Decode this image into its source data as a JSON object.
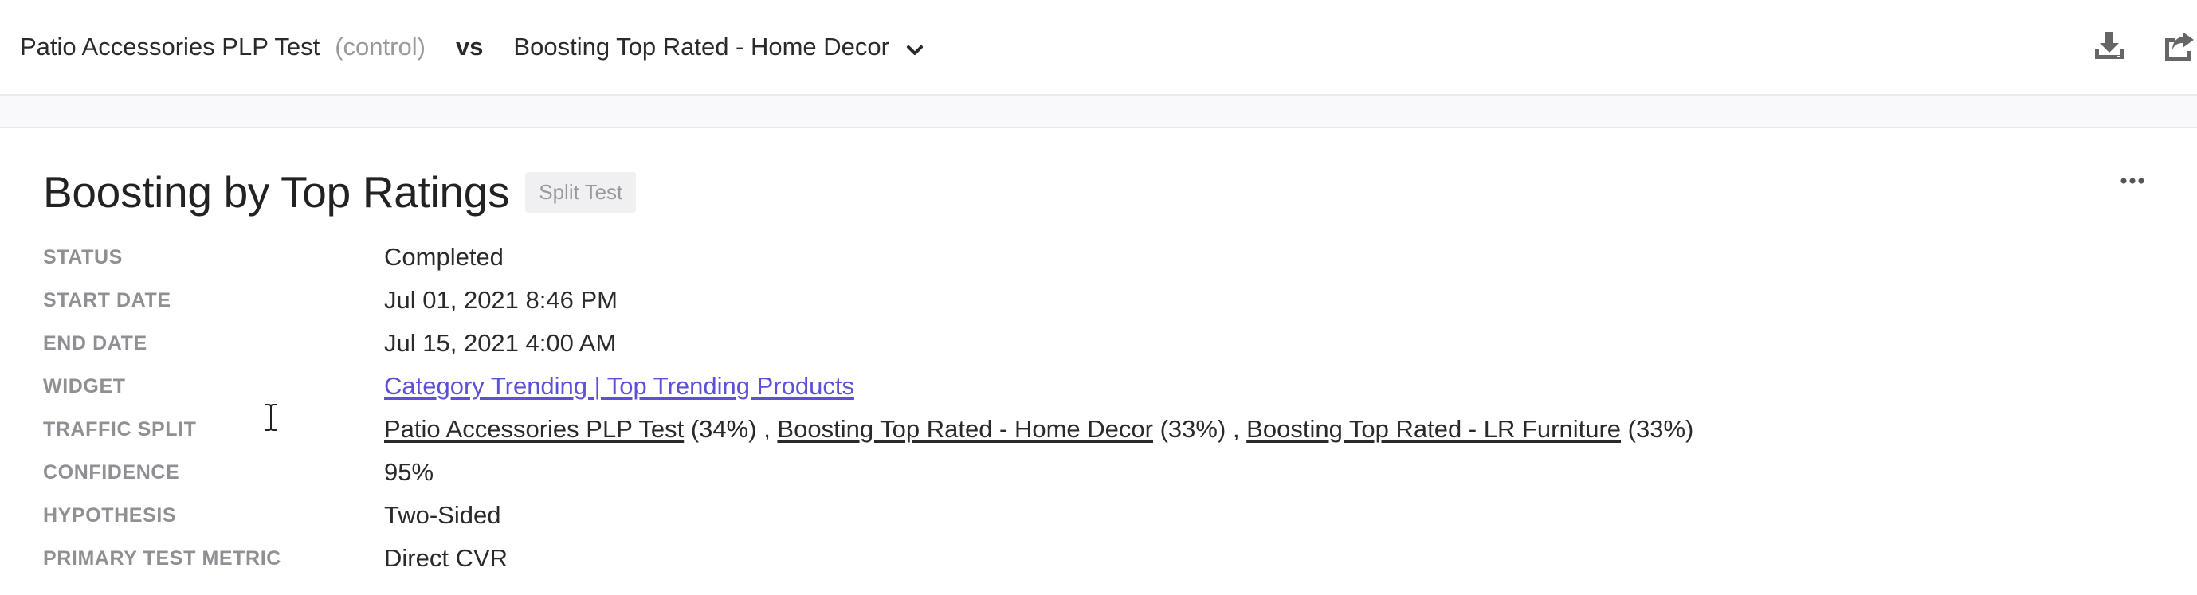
{
  "header": {
    "experiment_a": "Patio Accessories PLP Test",
    "control_tag": "(control)",
    "vs_label": "vs",
    "experiment_b": "Boosting Top Rated - Home Decor",
    "dropdown_icon": "chevron-down-icon",
    "download_icon": "download-icon",
    "share_icon": "share-export-icon"
  },
  "panel": {
    "title": "Boosting by Top Ratings",
    "type_badge": "Split Test",
    "more_icon": "more-horizontal-icon"
  },
  "fields": {
    "status": {
      "label": "STATUS",
      "value": "Completed"
    },
    "start_date": {
      "label": "START DATE",
      "value": "Jul 01, 2021 8:46 PM"
    },
    "end_date": {
      "label": "END DATE",
      "value": "Jul 15, 2021 4:00 AM"
    },
    "widget": {
      "label": "WIDGET",
      "value": "Category Trending | Top Trending Products"
    },
    "traffic_split": {
      "label": "TRAFFIC SPLIT",
      "items": [
        {
          "name": "Patio Accessories PLP Test",
          "pct": "(34%)",
          "sep": " , "
        },
        {
          "name": "Boosting Top Rated - Home Decor",
          "pct": "(33%)",
          "sep": " , "
        },
        {
          "name": "Boosting Top Rated - LR Furniture",
          "pct": "(33%)",
          "sep": ""
        }
      ]
    },
    "confidence": {
      "label": "CONFIDENCE",
      "value": "95%"
    },
    "hypothesis": {
      "label": "HYPOTHESIS",
      "value": "Two-Sided"
    },
    "primary_metric": {
      "label": "PRIMARY TEST METRIC",
      "value": "Direct CVR"
    }
  },
  "colors": {
    "link_accent": "#5b50d6",
    "label_gray": "#8f8f94",
    "badge_bg": "#f0f0f3",
    "strip_bg": "#f9f9fc"
  }
}
